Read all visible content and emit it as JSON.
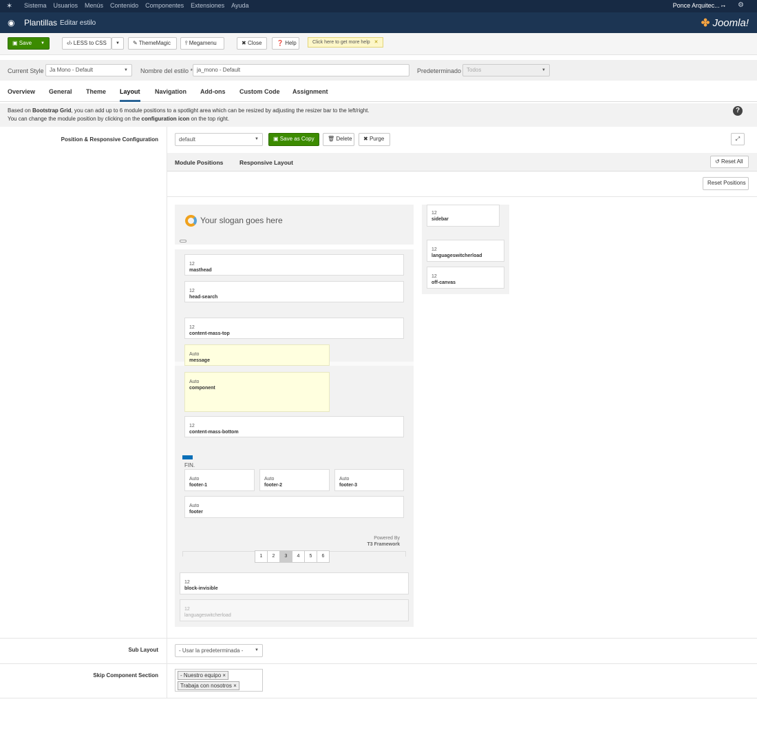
{
  "topbar": {
    "logo": "joomla-icon",
    "menu": [
      "Sistema",
      "Usuarios",
      "Menús",
      "Contenido",
      "Componentes",
      "Extensiones",
      "Ayuda"
    ],
    "user": "Ponce Arquitec...",
    "user_icon": "↦"
  },
  "header": {
    "title": "Plantillas",
    "subtitle": "Editar estilo",
    "brand": "Joomla!"
  },
  "toolbar": {
    "save": "Save",
    "less": "LESS to CSS",
    "thememagic": "ThemeMagic",
    "megamenu": "Megamenu",
    "close": "Close",
    "help": "Help",
    "tip": "Click here to get more help"
  },
  "style": {
    "current_label": "Current Style",
    "current_value": "Ja Mono - Default",
    "name_label": "Nombre del estilo *",
    "name_value": "ja_mono - Default",
    "default_label": "Predeterminado",
    "default_value": "Todos"
  },
  "tabs": [
    "Overview",
    "General",
    "Theme",
    "Layout",
    "Navigation",
    "Add-ons",
    "Custom Code",
    "Assignment"
  ],
  "info": {
    "l1a": "Based on ",
    "l1b": "Bootstrap Grid",
    "l1c": ", you can add up to 6 module positions to a spotlight area which can be resized by adjusting the resizer bar to the left/right.",
    "l2a": "You can change the module position by clicking on the ",
    "l2b": "configuration icon",
    "l2c": " on the top right."
  },
  "config": {
    "label": "Position & Responsive Configuration",
    "layout_value": "default",
    "save_copy": "Save as Copy",
    "delete": "Delete",
    "purge": "Purge"
  },
  "subtabs": {
    "positions": "Module Positions",
    "responsive": "Responsive Layout",
    "reset_all": "Reset All",
    "reset_positions": "Reset Positions"
  },
  "layout": {
    "slogan": "Your slogan goes here",
    "fin": "FIN.",
    "powered1": "Powered By",
    "powered2": "T3 Framework",
    "pages": [
      "1",
      "2",
      "3",
      "4",
      "5",
      "6"
    ],
    "positions": {
      "masthead": {
        "size": "12",
        "name": "masthead"
      },
      "head_search": {
        "size": "12",
        "name": "head-search"
      },
      "cmt": {
        "size": "12",
        "name": "content-mass-top"
      },
      "message": {
        "size": "Auto",
        "name": "message"
      },
      "component": {
        "size": "Auto",
        "name": "component"
      },
      "cmb": {
        "size": "12",
        "name": "content-mass-bottom"
      },
      "f1": {
        "size": "Auto",
        "name": "footer-1"
      },
      "f2": {
        "size": "Auto",
        "name": "footer-2"
      },
      "f3": {
        "size": "Auto",
        "name": "footer-3"
      },
      "footer": {
        "size": "Auto",
        "name": "footer"
      },
      "block_invisible": {
        "size": "12",
        "name": "block-invisible"
      },
      "lang_dim": {
        "size": "12",
        "name": "languageswitcherload"
      },
      "sidebar": {
        "size": "12",
        "name": "sidebar"
      },
      "lang": {
        "size": "12",
        "name": "languageswitcherload"
      },
      "offcanvas": {
        "size": "12",
        "name": "off-canvas"
      }
    }
  },
  "sublayout": {
    "label": "Sub Layout",
    "value": "- Usar la predeterminada -"
  },
  "skip": {
    "label": "Skip Component Section",
    "chips": [
      "- Nuestro equipo",
      "Trabaja con nosotros"
    ]
  },
  "colors": {
    "topbar": "#172a44",
    "header": "#1c3553",
    "save_green": "#3c8b00",
    "highlight": "#ffffdf",
    "accent_blue": "#0a6fb7"
  }
}
